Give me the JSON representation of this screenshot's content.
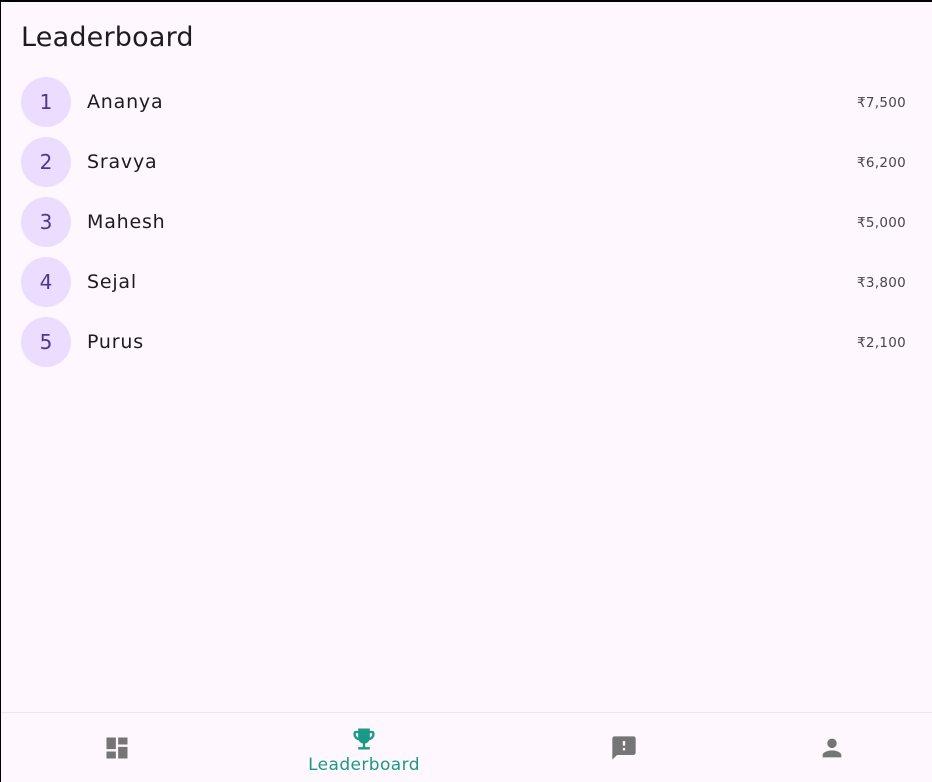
{
  "header": {
    "title": "Leaderboard"
  },
  "leaderboard": [
    {
      "rank": "1",
      "name": "Ananya",
      "amount": "₹7,500"
    },
    {
      "rank": "2",
      "name": "Sravya",
      "amount": "₹6,200"
    },
    {
      "rank": "3",
      "name": "Mahesh",
      "amount": "₹5,000"
    },
    {
      "rank": "4",
      "name": "Sejal",
      "amount": "₹3,800"
    },
    {
      "rank": "5",
      "name": "Purus",
      "amount": "₹2,100"
    }
  ],
  "nav": {
    "active_label": "Leaderboard",
    "items": [
      {
        "icon": "dashboard-icon"
      },
      {
        "icon": "trophy-icon"
      },
      {
        "icon": "feedback-icon"
      },
      {
        "icon": "person-icon"
      }
    ]
  },
  "colors": {
    "background": "#fef7fd",
    "rank_bg": "#eaddff",
    "rank_text": "#4f378b",
    "active": "#1a9a86",
    "inactive_icon": "#757575"
  }
}
